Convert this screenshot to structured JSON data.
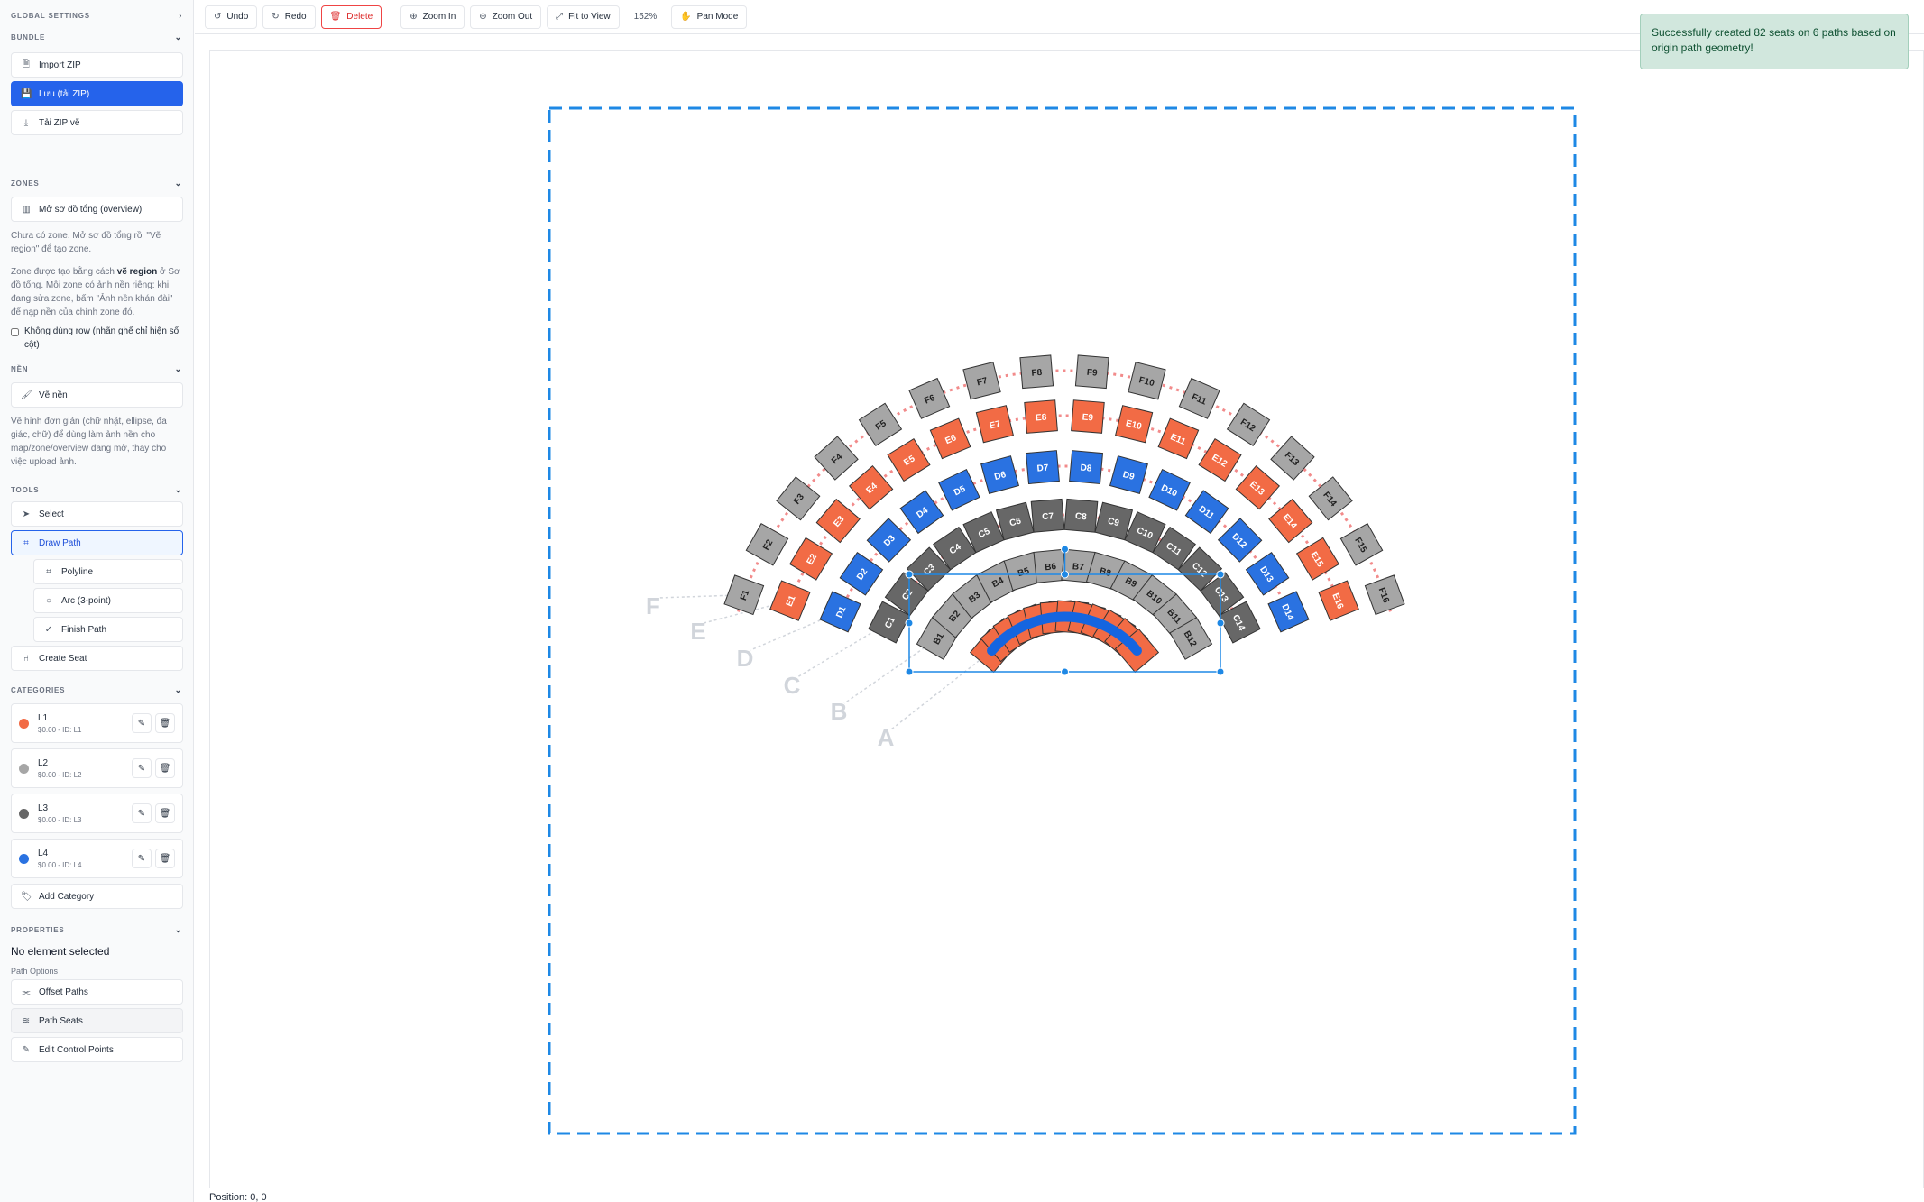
{
  "colors": {
    "L1": "#f26b45",
    "L2": "#a6a6a6",
    "L3": "#676767",
    "L4": "#2a72e1",
    "accent": "#2563eb"
  },
  "sidebar": {
    "global_settings": "GLOBAL SETTINGS",
    "bundle": {
      "title": "BUNDLE",
      "import": "Import ZIP",
      "save": "Lưu (tải ZIP)",
      "download": "Tải ZIP vẽ"
    },
    "zones": {
      "title": "ZONES",
      "open_overview": "Mở sơ đồ tổng (overview)",
      "help1": "Chưa có zone. Mở sơ đồ tổng rồi \"Vẽ region\" để tạo zone.",
      "help2_a": "Zone được tạo bằng cách ",
      "help2_b": "vẽ region",
      "help2_c": " ở Sơ đồ tổng. Mỗi zone có ảnh nền riêng: khi đang sửa zone, bấm \"Ảnh nền khán đài\" để nạp nền của chính zone đó.",
      "no_row_label": "Không dùng row (nhãn ghế chỉ hiện số cột)"
    },
    "bg": {
      "title": "NỀN",
      "draw_bg": "Vẽ nền",
      "help": "Vẽ hình đơn giản (chữ nhật, ellipse, đa giác, chữ) để dùng làm ảnh nền cho map/zone/overview đang mở, thay cho việc upload ảnh."
    },
    "tools": {
      "title": "TOOLS",
      "select": "Select",
      "draw_path": "Draw Path",
      "polyline": "Polyline",
      "arc": "Arc (3-point)",
      "finish_path": "Finish Path",
      "create_seat": "Create Seat"
    },
    "categories": {
      "title": "CATEGORIES",
      "items": [
        {
          "name": "L1",
          "meta": "$0.00 - ID: L1",
          "color": "#f26b45"
        },
        {
          "name": "L2",
          "meta": "$0.00 - ID: L2",
          "color": "#a6a6a6"
        },
        {
          "name": "L3",
          "meta": "$0.00 - ID: L3",
          "color": "#676767"
        },
        {
          "name": "L4",
          "meta": "$0.00 - ID: L4",
          "color": "#2a72e1"
        }
      ],
      "add": "Add Category"
    },
    "properties": {
      "title": "PROPERTIES",
      "none": "No element selected",
      "path_options": "Path Options",
      "offset_paths": "Offset Paths",
      "path_seats": "Path Seats",
      "edit_control_points": "Edit Control Points"
    }
  },
  "toolbar": {
    "undo": "Undo",
    "redo": "Redo",
    "delete": "Delete",
    "zoom_in": "Zoom In",
    "zoom_out": "Zoom Out",
    "fit": "Fit to View",
    "zoom_level": "152%",
    "pan": "Pan Mode"
  },
  "status": "Position: 0, 0",
  "toast": "Successfully created 82 seats on 6 paths based on origin path geometry!",
  "seat_map": {
    "rows": [
      {
        "label": "A",
        "count": 12,
        "colors": [
          "L1",
          "L1",
          "L1",
          "L1",
          "L1",
          "L1",
          "L1",
          "L1",
          "L1",
          "L1",
          "L1",
          "L1"
        ],
        "labels": []
      },
      {
        "label": "B",
        "count": 12,
        "colors": [
          "L2",
          "L2",
          "L2",
          "L2",
          "L2",
          "L2",
          "L2",
          "L2",
          "L2",
          "L2",
          "L2",
          "L2"
        ],
        "labels": [
          "B1",
          "B2",
          "B3",
          "B4",
          "B5",
          "B6",
          "B7",
          "B8",
          "B9",
          "B10",
          "B11",
          "B12"
        ]
      },
      {
        "label": "C",
        "count": 14,
        "colors": [
          "L3",
          "L3",
          "L3",
          "L3",
          "L3",
          "L3",
          "L3",
          "L3",
          "L3",
          "L3",
          "L3",
          "L3",
          "L3",
          "L3"
        ],
        "labels": [
          "C1",
          "C2",
          "C3",
          "C4",
          "C5",
          "C6",
          "C7",
          "C8",
          "C9",
          "C10",
          "C11",
          "C12",
          "C13",
          "C14"
        ]
      },
      {
        "label": "D",
        "count": 14,
        "colors": [
          "L4",
          "L4",
          "L4",
          "L4",
          "L4",
          "L4",
          "L4",
          "L4",
          "L4",
          "L4",
          "L4",
          "L4",
          "L4",
          "L4"
        ],
        "labels": [
          "D1",
          "D2",
          "D3",
          "D4",
          "D5",
          "D6",
          "D7",
          "D8",
          "D9",
          "D10",
          "D11",
          "D12",
          "D13",
          "D14"
        ]
      },
      {
        "label": "E",
        "count": 16,
        "colors": [
          "L1",
          "L1",
          "L1",
          "L1",
          "L1",
          "L1",
          "L1",
          "L1",
          "L1",
          "L1",
          "L1",
          "L1",
          "L1",
          "L1",
          "L1",
          "L1"
        ],
        "labels": [
          "E1",
          "E2",
          "E3",
          "E4",
          "E5",
          "E6",
          "E7",
          "E8",
          "E9",
          "E10",
          "E11",
          "E12",
          "E13",
          "E14",
          "E15",
          "E16"
        ]
      },
      {
        "label": "F",
        "count": 16,
        "colors": [
          "L2",
          "L2",
          "L2",
          "L2",
          "L2",
          "L2",
          "L2",
          "L2",
          "L2",
          "L2",
          "L2",
          "L2",
          "L2",
          "L2",
          "L2",
          "L2"
        ],
        "labels": [
          "F1",
          "F2",
          "F3",
          "F4",
          "F5",
          "F6",
          "F7",
          "F8",
          "F9",
          "F10",
          "F11",
          "F12",
          "F13",
          "F14",
          "F15",
          "F16"
        ]
      }
    ]
  }
}
